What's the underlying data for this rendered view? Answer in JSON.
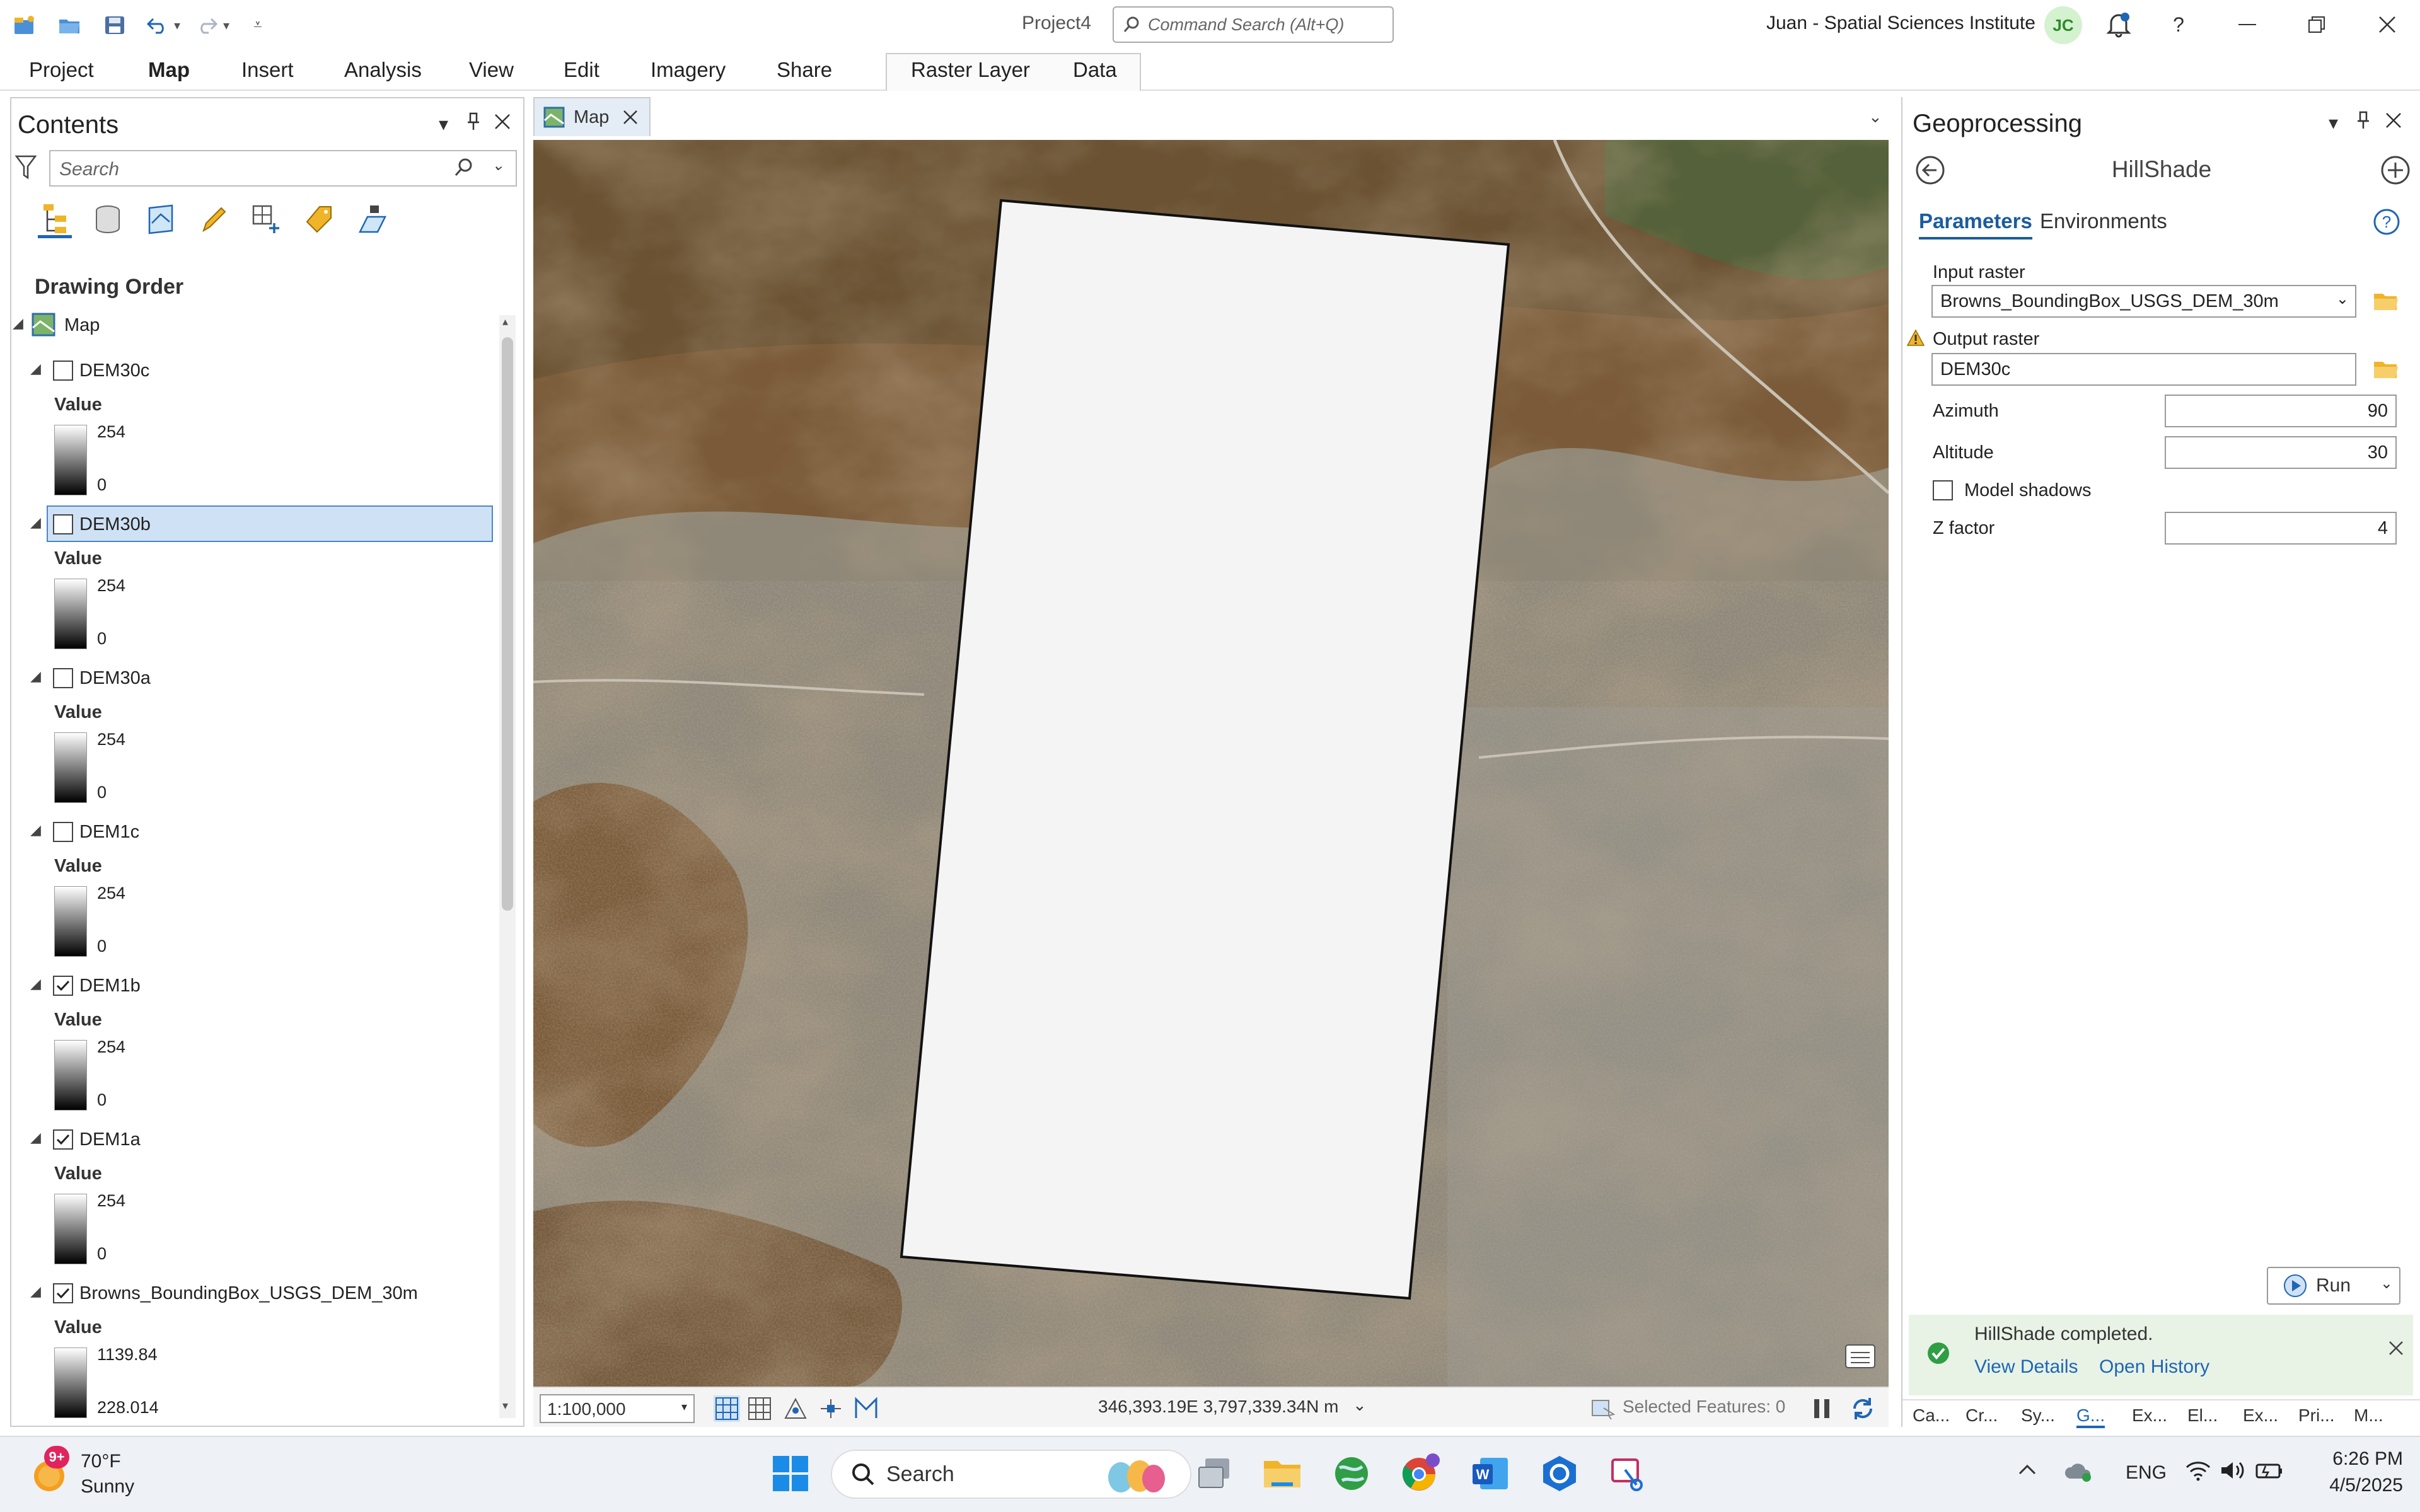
{
  "titlebar": {
    "project_title": "Project4",
    "command_search_placeholder": "Command Search (Alt+Q)",
    "user_label": "Juan  -  Spatial Sciences Institute",
    "avatar_initials": "JC",
    "help_label": "?"
  },
  "ribbon": {
    "tabs": [
      "Project",
      "Map",
      "Insert",
      "Analysis",
      "View",
      "Edit",
      "Imagery",
      "Share"
    ],
    "active_tab": "Map",
    "contextual_tabs": [
      "Raster Layer",
      "Data"
    ]
  },
  "contents": {
    "title": "Contents",
    "search_placeholder": "Search",
    "drawing_order_label": "Drawing Order",
    "map_label": "Map",
    "layers": [
      {
        "name": "DEM30c",
        "checked": false,
        "selected": false,
        "value_label": "Value",
        "max": "254",
        "min": "0"
      },
      {
        "name": "DEM30b",
        "checked": false,
        "selected": true,
        "value_label": "Value",
        "max": "254",
        "min": "0"
      },
      {
        "name": "DEM30a",
        "checked": false,
        "selected": false,
        "value_label": "Value",
        "max": "254",
        "min": "0"
      },
      {
        "name": "DEM1c",
        "checked": false,
        "selected": false,
        "value_label": "Value",
        "max": "254",
        "min": "0"
      },
      {
        "name": "DEM1b",
        "checked": true,
        "selected": false,
        "value_label": "Value",
        "max": "254",
        "min": "0"
      },
      {
        "name": "DEM1a",
        "checked": true,
        "selected": false,
        "value_label": "Value",
        "max": "254",
        "min": "0"
      },
      {
        "name": "Browns_BoundingBox_USGS_DEM_30m",
        "checked": true,
        "selected": false,
        "value_label": "Value",
        "max": "1139.84",
        "min": "228.014"
      }
    ]
  },
  "map": {
    "tab_label": "Map",
    "scale": "1:100,000",
    "coordinates": "346,393.19E 3,797,339.34N m",
    "selected_features": "Selected Features: 0"
  },
  "geoprocessing": {
    "title": "Geoprocessing",
    "tool_name": "HillShade",
    "tabs": [
      "Parameters",
      "Environments"
    ],
    "active_tab": "Parameters",
    "input_raster_label": "Input raster",
    "input_raster_value": "Browns_BoundingBox_USGS_DEM_30m",
    "output_raster_label": "Output raster",
    "output_raster_value": "DEM30c",
    "azimuth_label": "Azimuth",
    "azimuth_value": "90",
    "altitude_label": "Altitude",
    "altitude_value": "30",
    "model_shadows_label": "Model shadows",
    "z_factor_label": "Z factor",
    "z_factor_value": "4",
    "run_label": "Run",
    "message_text": "HillShade completed.",
    "view_details_label": "View Details",
    "open_history_label": "Open History",
    "bottom_tabs": [
      "Ca...",
      "Cr...",
      "Sy...",
      "G...",
      "Ex...",
      "El...",
      "Ex...",
      "Pri...",
      "M..."
    ],
    "active_bottom_tab": "G..."
  },
  "taskbar": {
    "weather_badge": "9+",
    "temperature": "70°F",
    "weather_desc": "Sunny",
    "search_label": "Search",
    "language": "ENG",
    "time": "6:26 PM",
    "date": "4/5/2025"
  },
  "colors": {
    "accent": "#1b5c9e",
    "selection": "#cfe2f5",
    "success_bg": "#e8f3e6",
    "success_icon": "#2f9e44"
  }
}
